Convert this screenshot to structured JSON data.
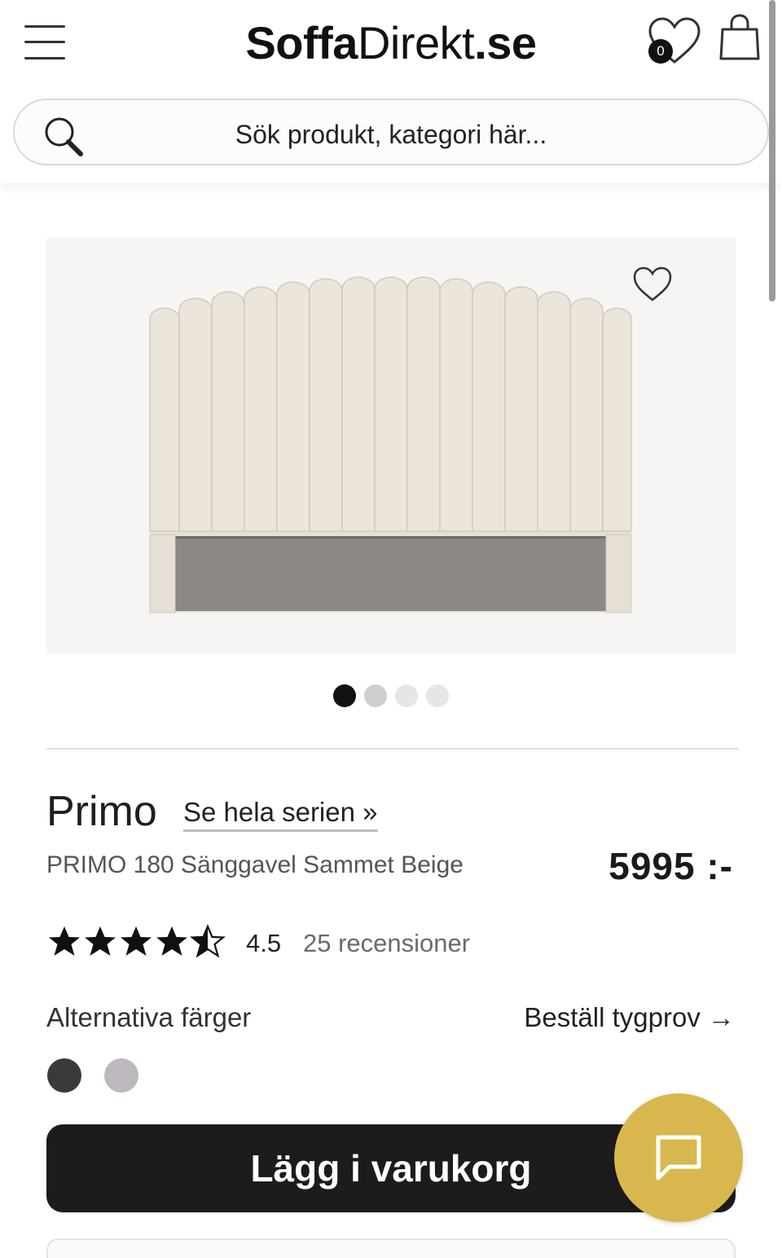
{
  "header": {
    "logo_part1": "Soffa",
    "logo_part2": "Direkt",
    "logo_part3": ".se",
    "wishlist_count": "0",
    "menu_icon": "hamburger-icon",
    "wishlist_icon": "heart-icon",
    "cart_icon": "shopping-bag-icon"
  },
  "search": {
    "placeholder": "Sök produkt, kategori här..."
  },
  "gallery": {
    "image_count": 4,
    "active_index": 0
  },
  "product": {
    "name": "Primo",
    "series_link": "Se hela serien »",
    "description": "PRIMO 180 Sänggavel Sammet Beige",
    "price": "5995 :-",
    "stars_display": "★★★★☆",
    "rating_value": "4.5",
    "reviews": "25 recensioner"
  },
  "colors": {
    "label": "Alternativa färger",
    "fabric_sample_link": "Beställ tygprov →",
    "swatches": [
      "#3a3a3a",
      "#bdb8bd"
    ]
  },
  "actions": {
    "add_to_cart": "Lägg i varukorg",
    "chat_icon": "chat-bubble-icon",
    "chat_color": "#d8b84e"
  }
}
